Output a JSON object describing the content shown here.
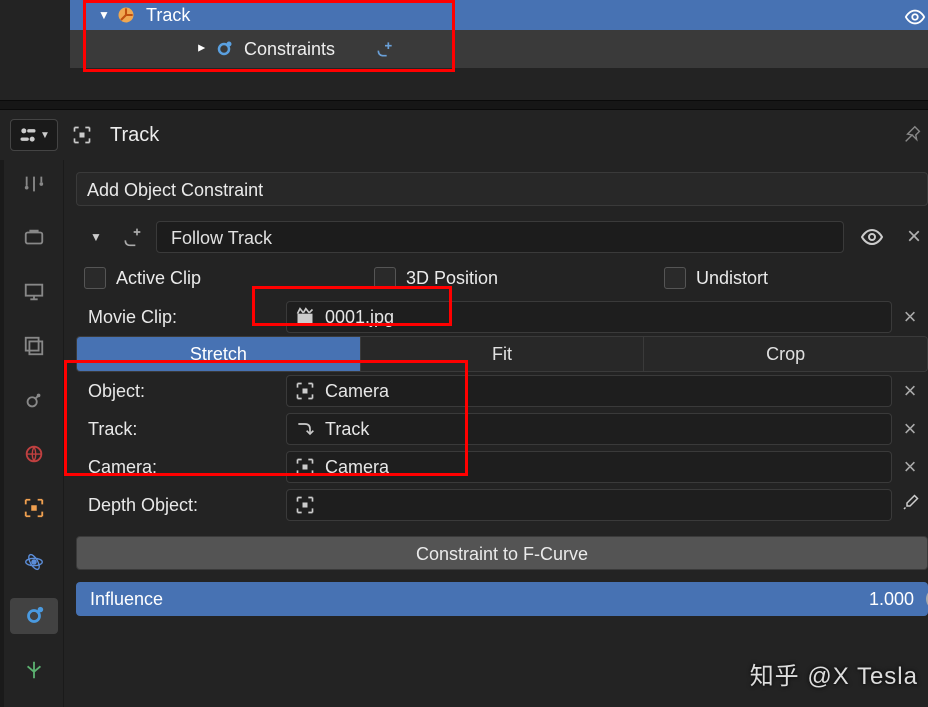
{
  "outliner": {
    "item": "Track",
    "child": "Constraints"
  },
  "header": {
    "title": "Track"
  },
  "panel": {
    "add_constraint": "Add Object Constraint",
    "constraint_name": "Follow Track"
  },
  "checkboxes": {
    "active_clip": "Active Clip",
    "three_d_pos": "3D Position",
    "undistort": "Undistort"
  },
  "fields": {
    "movie_clip_label": "Movie Clip:",
    "movie_clip_value": "0001.jpg",
    "object_label": "Object:",
    "object_value": "Camera",
    "track_label": "Track:",
    "track_value": "Track",
    "camera_label": "Camera:",
    "camera_value": "Camera",
    "depth_label": "Depth Object:",
    "depth_value": ""
  },
  "tabs": {
    "stretch": "Stretch",
    "fit": "Fit",
    "crop": "Crop"
  },
  "action": {
    "fcurve": "Constraint to F-Curve"
  },
  "slider": {
    "label": "Influence",
    "value": "1.000"
  },
  "watermark": "知乎 @X Tesla"
}
